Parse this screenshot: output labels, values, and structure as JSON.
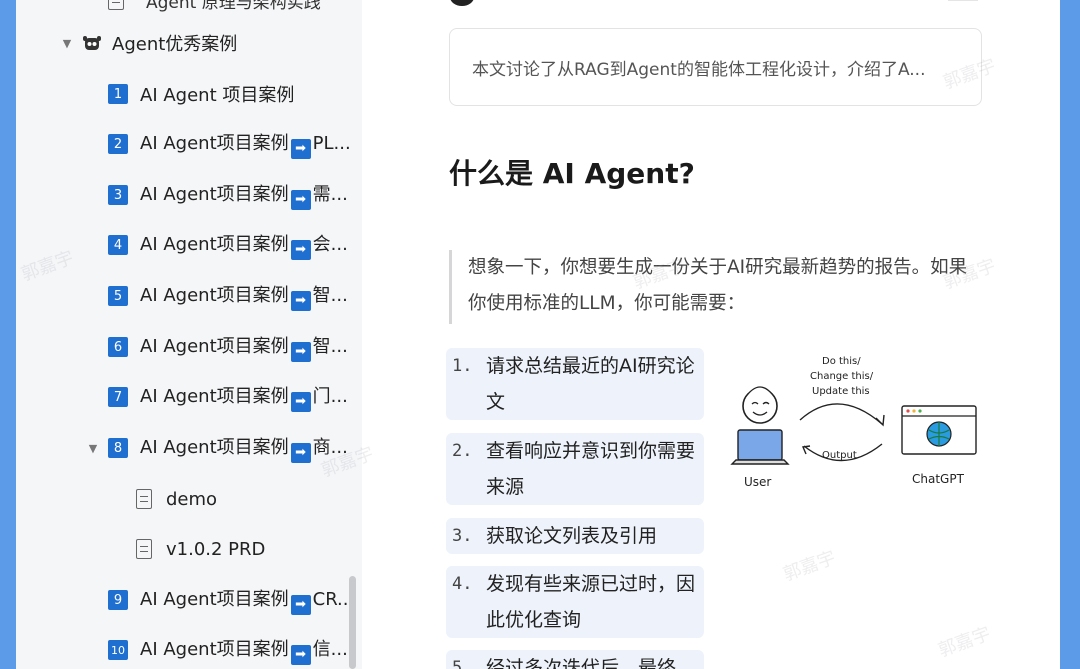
{
  "sidebar": {
    "partial_top_item": "Agent 原理与架构实践",
    "group": {
      "label": "Agent优秀案例",
      "icon": "robot-icon"
    },
    "items": [
      {
        "num": "1",
        "label": "AI Agent 项目案例",
        "arrow": false,
        "suffix": ""
      },
      {
        "num": "2",
        "label": "AI Agent项目案例",
        "arrow": true,
        "suffix": "PL..."
      },
      {
        "num": "3",
        "label": "AI Agent项目案例",
        "arrow": true,
        "suffix": "需..."
      },
      {
        "num": "4",
        "label": "AI Agent项目案例",
        "arrow": true,
        "suffix": "会..."
      },
      {
        "num": "5",
        "label": "AI Agent项目案例",
        "arrow": true,
        "suffix": "智..."
      },
      {
        "num": "6",
        "label": "AI Agent项目案例",
        "arrow": true,
        "suffix": "智..."
      },
      {
        "num": "7",
        "label": "AI Agent项目案例",
        "arrow": true,
        "suffix": "门..."
      },
      {
        "num": "8",
        "label": "AI Agent项目案例",
        "arrow": true,
        "suffix": "商..."
      },
      {
        "num": "9",
        "label": "AI Agent项目案例",
        "arrow": true,
        "suffix": "CR..."
      },
      {
        "num": "10",
        "label": "AI Agent项目案例",
        "arrow": true,
        "suffix": "信..."
      }
    ],
    "subdocs": [
      "demo",
      "v1.0.2 PRD"
    ],
    "arrow_glyph": "➡"
  },
  "main": {
    "summary": "本文讨论了从RAG到Agent的智能体工程化设计，介绍了A...",
    "heading": "什么是 AI Agent?",
    "quote": "想象一下，你想要生成一份关于AI研究最新趋势的报告。如果你使用标准的LLM，你可能需要：",
    "steps": [
      {
        "num": "1.",
        "text": "请求总结最近的AI研究论文"
      },
      {
        "num": "2.",
        "text": "查看响应并意识到你需要来源"
      },
      {
        "num": "3.",
        "text": "获取论文列表及引用"
      },
      {
        "num": "4.",
        "text": "发现有些来源已过时，因此优化查询"
      },
      {
        "num": "5.",
        "text": "经过多次迭代后，最终"
      }
    ],
    "diagram": {
      "top_label_1": "Do this/",
      "top_label_2": "Change this/",
      "top_label_3": "Update this",
      "bottom_label": "Output",
      "user_label": "User",
      "bot_label": "ChatGPT"
    }
  },
  "watermark": "郭嘉宇",
  "colors": {
    "accent": "#1f6fd1",
    "step_bg": "#eef3fb",
    "frame": "#5b9be8"
  }
}
